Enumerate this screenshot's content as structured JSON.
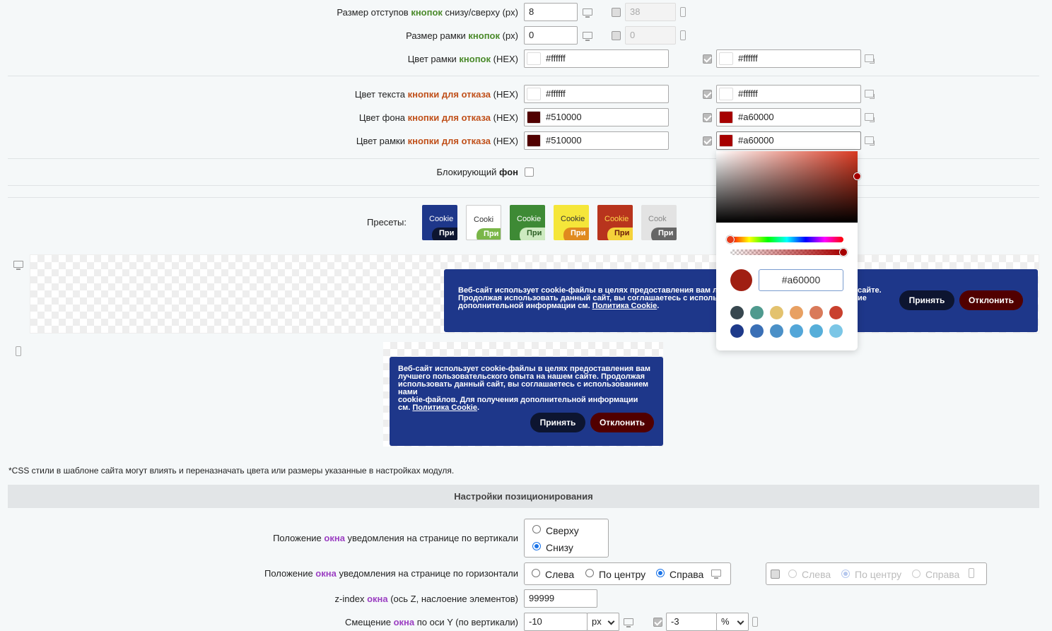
{
  "rows": {
    "pad_label": [
      "Размер отступов ",
      "кнопок",
      " снизу/сверху (px)"
    ],
    "pad_value": "8",
    "pad_mobile_value": "38",
    "border_label": [
      "Размер рамки ",
      "кнопок",
      " (px)"
    ],
    "border_value": "0",
    "border_mobile_value": "0",
    "bcolor_label": [
      "Цвет рамки ",
      "кнопок",
      " (HEX)"
    ],
    "bcolor_value": "#ffffff",
    "bcolor_mobile_value": "#ffffff",
    "dtext_label": [
      "Цвет текста ",
      "кнопки для отказа",
      " (HEX)"
    ],
    "dtext_value": "#ffffff",
    "dtext_mobile_value": "#ffffff",
    "dbg_label": [
      "Цвет фона ",
      "кнопки для отказа",
      " (HEX)"
    ],
    "dbg_value": "#510000",
    "dbg_mobile_value": "#a60000",
    "dborder_label": [
      "Цвет рамки ",
      "кнопки для отказа",
      " (HEX)"
    ],
    "dborder_value": "#510000",
    "dborder_mobile_value": "#a60000",
    "blocking_label": [
      "Блокирующий ",
      "фон"
    ],
    "presets_label": "Пресеты:"
  },
  "presets": [
    {
      "text": "Cookie",
      "btn": "При",
      "bg": "#1e378a",
      "fg": "#ffffff",
      "btnbg": "#0d1530",
      "btnfg": "#ffffff"
    },
    {
      "text": "Cooki",
      "btn": "При",
      "bg": "#ffffff",
      "fg": "#333333",
      "btnbg": "#7ab648",
      "btnfg": "#ffffff"
    },
    {
      "text": "Cookie",
      "btn": "При",
      "bg": "#3e8a35",
      "fg": "#ffffff",
      "btnbg": "#cdeac0",
      "btnfg": "#2c5f24"
    },
    {
      "text": "Cookie",
      "btn": "При",
      "bg": "#f5e63a",
      "fg": "#333333",
      "btnbg": "#e08a1e",
      "btnfg": "#ffffff"
    },
    {
      "text": "Cookie",
      "btn": "При",
      "bg": "#b8341d",
      "fg": "#ffd84a",
      "btnbg": "#f5d23a",
      "btnfg": "#6b1a0a"
    },
    {
      "text": "Cook",
      "btn": "При",
      "bg": "#e3e3e3",
      "fg": "#888888",
      "btnbg": "#666666",
      "btnfg": "#ffffff"
    }
  ],
  "desktop_banner": {
    "line1": "Веб-сайт использует cookie-файлы в целях предоставления вам лучше",
    "line1_end": "сайте.",
    "line2": "Продолжая использовать данный сайт, вы соглашаетесь с использован",
    "line2_end": "ие",
    "line3": "дополнительной информации см. ",
    "link": "Политика Cookie",
    "dot": ".",
    "accept": "Принять",
    "decline": "Отклонить"
  },
  "mobile_banner": {
    "lines": [
      "Веб-сайт использует cookie-файлы в целях предоставления вам",
      "лучшего пользовательского опыта на нашем сайте. Продолжая",
      "использовать данный сайт, вы соглашаетесь с использованием нами",
      "cookie-файлов. Для получения дополнительной информации"
    ],
    "last_prefix": "см. ",
    "link": "Политика Cookie",
    "dot": ".",
    "accept": "Принять",
    "decline": "Отклонить"
  },
  "picker": {
    "hex": "#a60000",
    "swatches_row1": [
      "#37474f",
      "#4f9a8e",
      "#e3c26e",
      "#e8a062",
      "#d97a5a",
      "#c9402e"
    ],
    "swatches_row2": [
      "#1e3a8a",
      "#3a6fb5",
      "#4b90c7",
      "#53a6d8",
      "#56aed9",
      "#7bc6e6"
    ]
  },
  "note": "*CSS стили в шаблоне сайта могут влиять и переназначать цвета или размеры указанные в настройках модуля.",
  "section_title": "Настройки позиционирования",
  "positioning": {
    "vert_label": [
      "Положение ",
      "окна",
      " уведомления на странице по вертикали"
    ],
    "vert_options": [
      "Сверху",
      "Снизу"
    ],
    "horiz_label": [
      "Положение ",
      "окна",
      " уведомления на странице по горизонтали"
    ],
    "horiz_options": [
      "Слева",
      "По центру",
      "Справа"
    ],
    "horiz_mobile_options": [
      "Слева",
      "По центру",
      "Справа"
    ],
    "z_label": [
      "z-index ",
      "окна",
      " (ось Z, наслоение элементов)"
    ],
    "z_value": "99999",
    "y_label": [
      "Смещение ",
      "окна",
      " по оси Y (по вертикали)"
    ],
    "y_value": "-10",
    "y_unit": "px",
    "y_mobile_value": "-3",
    "y_mobile_unit": "%"
  },
  "colors": {
    "white": "#ffffff",
    "dark_red": "#510000",
    "red": "#a60000",
    "banner_bg": "#1e378a"
  }
}
